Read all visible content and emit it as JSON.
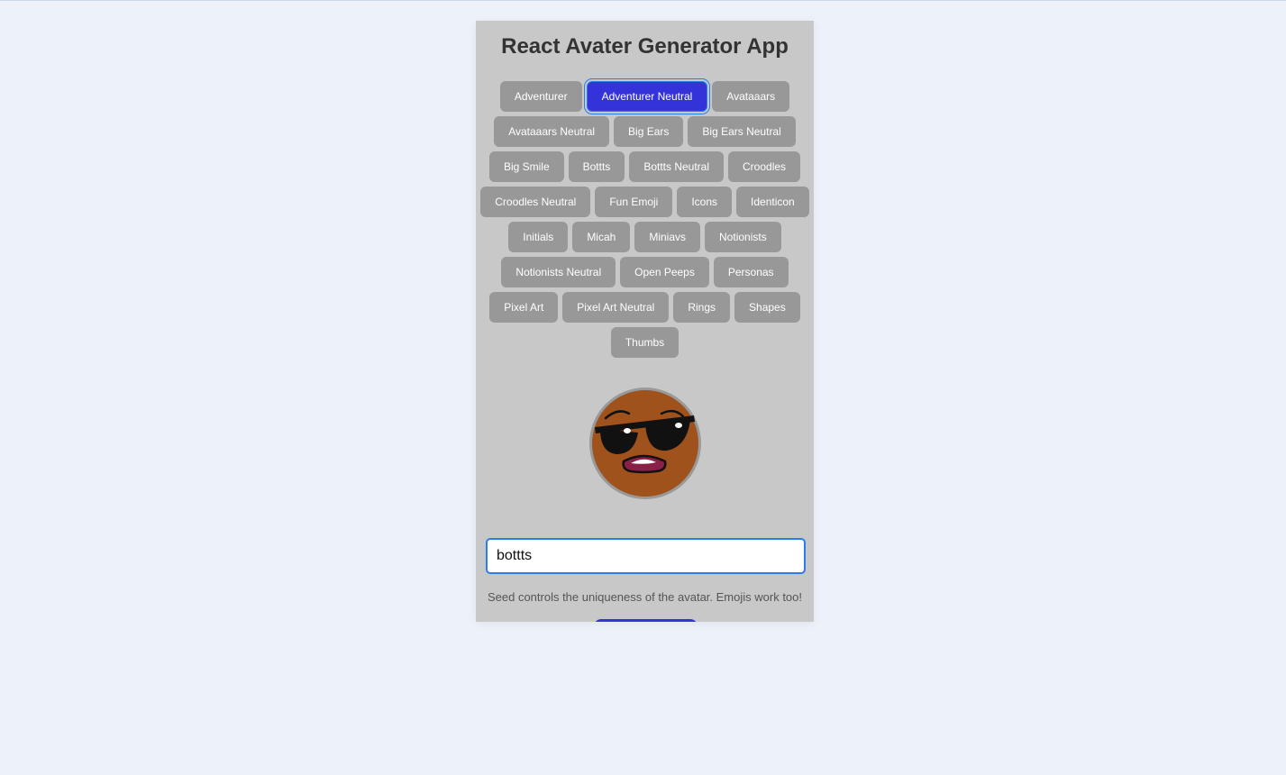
{
  "app": {
    "title": "React Avater Generator App"
  },
  "styles": {
    "active": "Adventurer Neutral",
    "items": [
      "Adventurer",
      "Adventurer Neutral",
      "Avataaars",
      "Avataaars Neutral",
      "Big Ears",
      "Big Ears Neutral",
      "Big Smile",
      "Bottts",
      "Bottts Neutral",
      "Croodles",
      "Croodles Neutral",
      "Fun Emoji",
      "Icons",
      "Identicon",
      "Initials",
      "Micah",
      "Miniavs",
      "Notionists",
      "Notionists Neutral",
      "Open Peeps",
      "Personas",
      "Pixel Art",
      "Pixel Art Neutral",
      "Rings",
      "Shapes",
      "Thumbs"
    ]
  },
  "avatar": {
    "icon": "avatar-face-sunglasses-icon",
    "skin_color": "#a0521d",
    "border_color": "#999999"
  },
  "seed": {
    "value": "bottts",
    "hint": "Seed controls the uniqueness of the avatar. Emojis work too!"
  },
  "colors": {
    "accent": "#3333d9",
    "button": "#989898",
    "panel": "#c8c8c8",
    "background": "#edf1f9"
  }
}
